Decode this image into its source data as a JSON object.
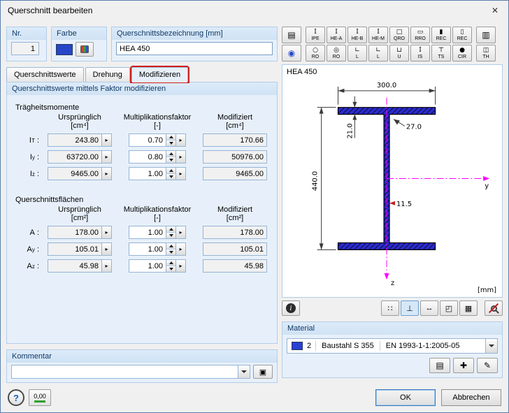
{
  "window": {
    "title": "Querschnitt bearbeiten",
    "close_glyph": "✕"
  },
  "header": {
    "nr_label": "Nr.",
    "nr_value": "1",
    "farbe_label": "Farbe",
    "farbe_color": "#2646c8",
    "bezeichnung_label": "Querschnittsbezeichnung [mm]",
    "bezeichnung_value": "HEA 450"
  },
  "tabs": {
    "items": [
      {
        "label": "Querschnittswerte"
      },
      {
        "label": "Drehung"
      },
      {
        "label": "Modifizieren"
      }
    ]
  },
  "controls": {
    "picker_glyph": "▸"
  },
  "modify": {
    "group_title": "Querschnittswerte mittels Faktor modifizieren",
    "label_suffix": ":",
    "inertia": {
      "section_title": "Trägheitsmomente",
      "headers": {
        "orig": "Ursprünglich",
        "orig_unit": "[cm⁴]",
        "factor": "Multiplikationsfaktor",
        "factor_unit": "[-]",
        "mod": "Modifiziert",
        "mod_unit": "[cm⁴]"
      },
      "rows": [
        {
          "base": "I",
          "sub": "T",
          "orig": "243.80",
          "factor": "0.70",
          "mod": "170.66"
        },
        {
          "base": "I",
          "sub": "y",
          "orig": "63720.00",
          "factor": "0.80",
          "mod": "50976.00"
        },
        {
          "base": "I",
          "sub": "z",
          "orig": "9465.00",
          "factor": "1.00",
          "mod": "9465.00"
        }
      ]
    },
    "areas": {
      "section_title": "Querschnittsflächen",
      "headers": {
        "orig": "Ursprünglich",
        "orig_unit": "[cm²]",
        "factor": "Multiplikationsfaktor",
        "factor_unit": "[-]",
        "mod": "Modifiziert",
        "mod_unit": "[cm²]"
      },
      "rows": [
        {
          "base": "A",
          "sub": "",
          "orig": "178.00",
          "factor": "1.00",
          "mod": "178.00"
        },
        {
          "base": "A",
          "sub": "y",
          "orig": "105.01",
          "factor": "1.00",
          "mod": "105.01"
        },
        {
          "base": "A",
          "sub": "z",
          "orig": "45.98",
          "factor": "1.00",
          "mod": "45.98"
        }
      ]
    }
  },
  "kommentar": {
    "label": "Kommentar",
    "copy_glyph": "▣"
  },
  "toolbar": {
    "row1": [
      {
        "glyph": "▤",
        "label": ""
      },
      {
        "glyph": "Ι",
        "label": "IPE"
      },
      {
        "glyph": "Ι",
        "label": "HE-A"
      },
      {
        "glyph": "Ι",
        "label": "HE-B"
      },
      {
        "glyph": "Ι",
        "label": "HE-M"
      },
      {
        "glyph": "□",
        "label": "QRO"
      },
      {
        "glyph": "▭",
        "label": "RRO"
      },
      {
        "glyph": "▮",
        "label": "REC"
      },
      {
        "glyph": "▯",
        "label": "REC"
      },
      {
        "glyph": "▥",
        "label": ""
      }
    ],
    "row2": [
      {
        "glyph": "◉",
        "label": ""
      },
      {
        "glyph": "○",
        "label": "RO"
      },
      {
        "glyph": "◎",
        "label": "RO"
      },
      {
        "glyph": "∟",
        "label": "L"
      },
      {
        "glyph": "∟",
        "label": "L"
      },
      {
        "glyph": "⊔",
        "label": "U"
      },
      {
        "glyph": "Ι",
        "label": "IS"
      },
      {
        "glyph": "⊤",
        "label": "TS"
      },
      {
        "glyph": "●",
        "label": "CIR"
      },
      {
        "glyph": "◫",
        "label": "TH"
      }
    ]
  },
  "preview": {
    "section_name": "HEA 450",
    "dim_width": "300.0",
    "dim_flange": "21.0",
    "dim_radius": "27.0",
    "dim_height": "440.0",
    "dim_web": "11.5",
    "axis_y": "y",
    "axis_z": "z",
    "units": "[mm]",
    "info_glyph": "i",
    "view_buttons": [
      {
        "name": "toggle-stress-points-button",
        "glyph": "∷"
      },
      {
        "name": "toggle-axes-button",
        "glyph": "⊥"
      },
      {
        "name": "toggle-dimensions-button",
        "glyph": "↔"
      },
      {
        "name": "toggle-outline-button",
        "glyph": "◰"
      },
      {
        "name": "toggle-values-button",
        "glyph": "▦"
      }
    ]
  },
  "material": {
    "label": "Material",
    "swatch_color": "#2a3fd4",
    "number": "2",
    "name": "Baustahl S 355",
    "norm": "EN 1993-1-1:2005-05",
    "library_glyph": "▤",
    "new_glyph": "✚",
    "edit_glyph": "✎"
  },
  "footer": {
    "help_glyph": "?",
    "units_label": "0,00",
    "ok": "OK",
    "cancel": "Abbrechen"
  }
}
